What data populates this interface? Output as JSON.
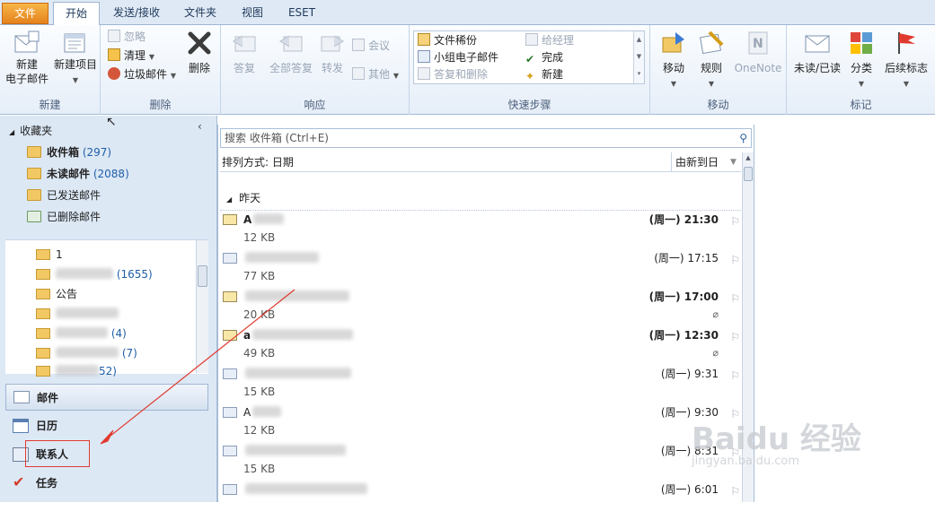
{
  "tabs": [
    "文件",
    "开始",
    "发送/接收",
    "文件夹",
    "视图",
    "ESET"
  ],
  "ribbon": {
    "new": {
      "new_mail": "新建\n电子邮件",
      "new_item": "新建项目",
      "group": "新建"
    },
    "delete": {
      "ignore": "忽略",
      "clean": "清理",
      "junk": "垃圾邮件",
      "delete": "删除",
      "group": "删除"
    },
    "respond": {
      "reply": "答复",
      "reply_all": "全部答复",
      "forward": "转发",
      "meeting": "会议",
      "more": "其他",
      "group": "响应"
    },
    "quick_steps": {
      "items": [
        "文件稀份",
        "给经理",
        "小组电子邮件",
        "完成",
        "答复和删除",
        "新建"
      ],
      "group": "快速步骤"
    },
    "move": {
      "move": "移动",
      "rules": "规则",
      "onenote": "OneNote",
      "group": "移动"
    },
    "tags": {
      "unread_read": "未读/已读",
      "categorize": "分类",
      "follow_up": "后续标志",
      "group": "标记"
    }
  },
  "nav": {
    "favorites_label": "收藏夹",
    "favorites": [
      {
        "name": "收件箱",
        "count": "(297)",
        "bold": true
      },
      {
        "name": "未读邮件",
        "count": "(2088)",
        "bold": true
      },
      {
        "name": "已发送邮件",
        "count": ""
      },
      {
        "name": "已删除邮件",
        "count": ""
      }
    ],
    "folders": [
      {
        "name": "1",
        "count": ""
      },
      {
        "name": "",
        "count": "(1655)"
      },
      {
        "name": "公告",
        "count": ""
      },
      {
        "name": "",
        "count": ""
      },
      {
        "name": "",
        "count": "(4)"
      },
      {
        "name": "",
        "count": "(7)"
      },
      {
        "name": "",
        "count": "52)"
      }
    ],
    "modules": [
      "邮件",
      "日历",
      "联系人",
      "任务"
    ]
  },
  "list": {
    "search_placeholder": "搜索 收件箱 (Ctrl+E)",
    "sort_label": "排列方式: 日期",
    "sort_order": "由新到日",
    "group_header": "昨天",
    "mails": [
      {
        "sender": "A",
        "size": "12 KB",
        "time": "(周一) 21:30",
        "unread": true,
        "attach": false
      },
      {
        "sender": "",
        "size": "77 KB",
        "time": "(周一) 17:15",
        "unread": false,
        "attach": false
      },
      {
        "sender": "",
        "size": "20 KB",
        "time": "(周一) 17:00",
        "unread": true,
        "attach": true
      },
      {
        "sender": "a",
        "size": "49 KB",
        "time": "(周一) 12:30",
        "unread": true,
        "attach": true
      },
      {
        "sender": "",
        "size": "15 KB",
        "time": "(周一) 9:31",
        "unread": false,
        "attach": false
      },
      {
        "sender": "A",
        "size": "12 KB",
        "time": "(周一) 9:30",
        "unread": false,
        "attach": false
      },
      {
        "sender": "",
        "size": "15 KB",
        "time": "(周一) 8:31",
        "unread": false,
        "attach": false
      },
      {
        "sender": "",
        "size": "",
        "time": "(周一) 6:01",
        "unread": false,
        "attach": false
      }
    ]
  },
  "watermark": "Baidu 经验",
  "watermark_sub": "jingyan.baidu.com"
}
